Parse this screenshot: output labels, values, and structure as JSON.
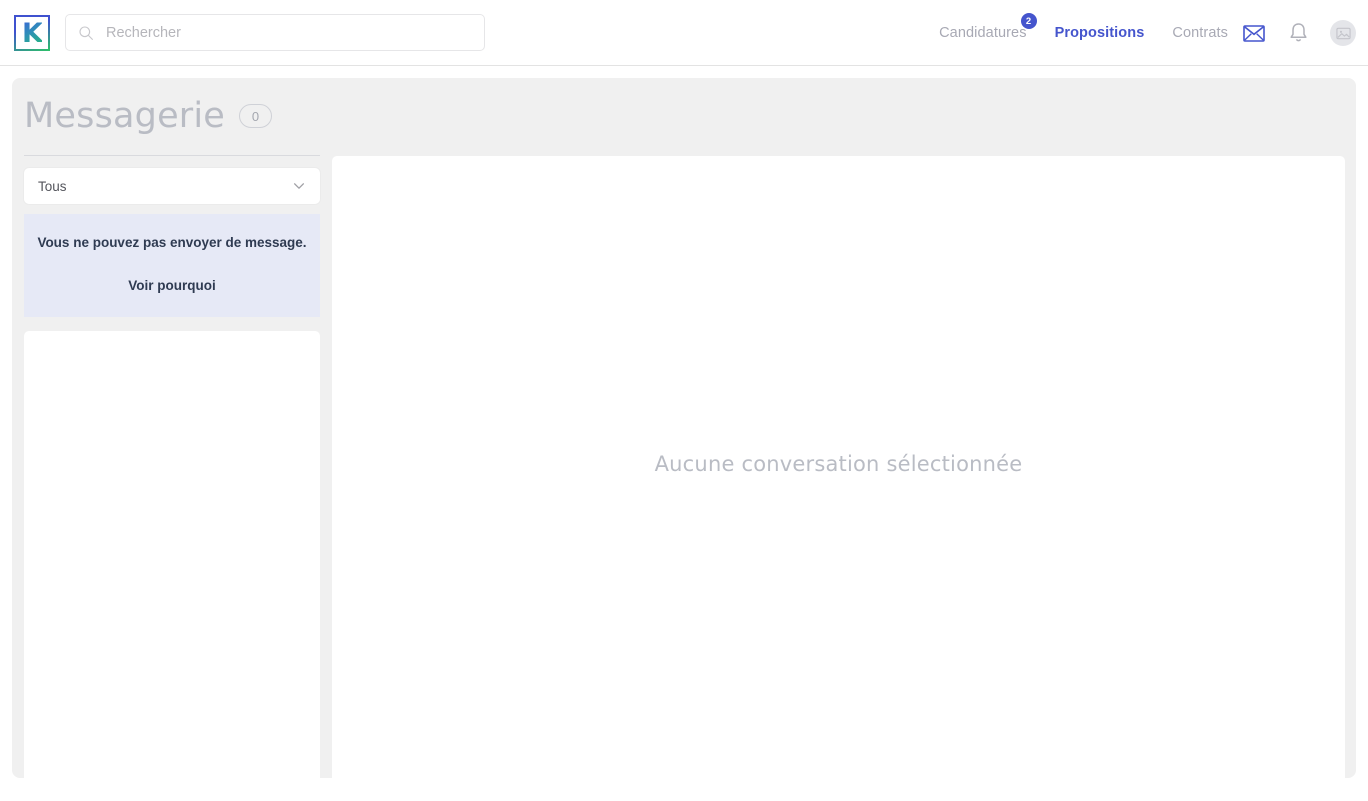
{
  "brand": {
    "logo_letter": "K",
    "accent_blue": "#4555cd",
    "accent_green": "#22bb77"
  },
  "header": {
    "search": {
      "placeholder": "Rechercher",
      "value": "",
      "icon": "search-icon"
    },
    "nav": [
      {
        "label": "Candidatures",
        "active": false,
        "badge": "2"
      },
      {
        "label": "Propositions",
        "active": true,
        "badge": ""
      },
      {
        "label": "Contrats",
        "active": false,
        "badge": ""
      }
    ],
    "icons": [
      {
        "name": "mail-icon",
        "active": true
      },
      {
        "name": "bell-icon",
        "active": false
      },
      {
        "name": "avatar-placeholder-icon",
        "active": false
      }
    ]
  },
  "page": {
    "title": "Messagerie",
    "count": "0"
  },
  "sidebar": {
    "filter": {
      "selected": "Tous",
      "chevron": "chevron-down-icon"
    },
    "notice": {
      "message": "Vous ne pouvez pas envoyer de message.",
      "link_label": "Voir pourquoi"
    },
    "conversations": []
  },
  "main": {
    "empty_state": "Aucune conversation sélectionnée"
  }
}
